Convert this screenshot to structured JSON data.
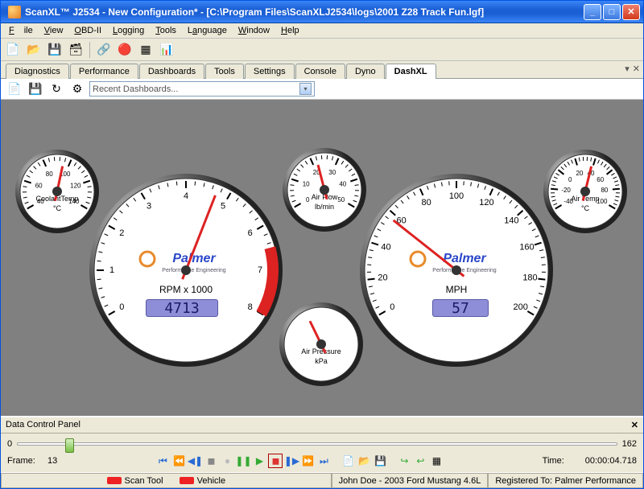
{
  "titlebar": {
    "app": "ScanXL™ J2534",
    "doc": "New Configuration*",
    "path": "[C:\\Program Files\\ScanXLJ2534\\logs\\2001 Z28 Track Fun.lgf]"
  },
  "menubar": [
    "File",
    "View",
    "OBD-II",
    "Logging",
    "Tools",
    "Language",
    "Window",
    "Help"
  ],
  "tabs": [
    "Diagnostics",
    "Performance",
    "Dashboards",
    "Tools",
    "Settings",
    "Console",
    "Dyno",
    "DashXL"
  ],
  "active_tab": 7,
  "subtoolbar": {
    "combo": "Recent Dashboards..."
  },
  "gauges": {
    "coolant": {
      "label": "CoolantTemp",
      "unit": "°C",
      "min": 40,
      "max": 140,
      "ticks": [
        40,
        60,
        80,
        100,
        120,
        140
      ],
      "value": 95
    },
    "airflow": {
      "label": "Air Flow",
      "unit": "lb/min",
      "min": 0,
      "max": 50,
      "ticks": [
        0,
        10,
        20,
        30,
        40,
        50
      ],
      "value": 22
    },
    "airtemp": {
      "label": "Air Temp",
      "unit": "°C",
      "min": -40,
      "max": 100,
      "ticks": [
        -40,
        -20,
        0,
        20,
        40,
        60,
        80,
        100
      ],
      "value": 38
    },
    "rpm": {
      "label": "RPM x 1000",
      "min": 0,
      "max": 8,
      "ticks": [
        0,
        1,
        2,
        3,
        4,
        5,
        6,
        7,
        8
      ],
      "value": 4.713,
      "redline": 6.5,
      "lcd": "4713",
      "brand": "Palmer",
      "brand2": "Performance Engineering"
    },
    "mph": {
      "label": "MPH",
      "min": 0,
      "max": 200,
      "ticks": [
        0,
        20,
        40,
        60,
        80,
        100,
        120,
        140,
        160,
        180,
        200
      ],
      "value": 57,
      "lcd": "57",
      "brand": "Palmer",
      "brand2": "Performance Engineering"
    },
    "kpa": {
      "label": "Air Pressure",
      "unit": "kPa",
      "min": 0,
      "max": 250,
      "value": 98
    }
  },
  "dcp": {
    "title": "Data Control Panel",
    "slider_min": "0",
    "slider_max": "162",
    "slider_pos_pct": 8,
    "frame_label": "Frame:",
    "frame": "13",
    "time_label": "Time:",
    "time": "00:00:04.718"
  },
  "status": {
    "scan_tool": "Scan Tool",
    "vehicle": "Vehicle",
    "user": "John Doe - 2003 Ford Mustang 4.6L",
    "reg": "Registered To: Palmer Performance"
  }
}
